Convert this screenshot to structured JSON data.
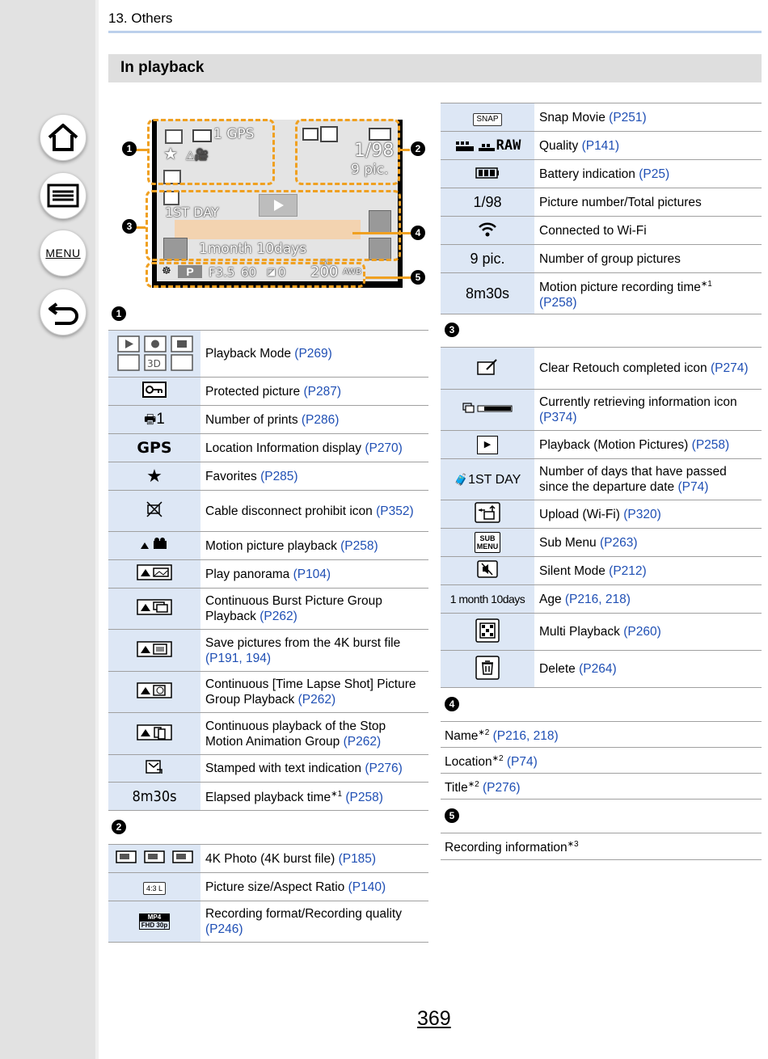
{
  "header": {
    "chapter": "13. Others",
    "section_title": "In playback"
  },
  "nav": {
    "menu_label": "MENU"
  },
  "page_number": "369",
  "screen": {
    "prints": "1 GPS",
    "picnum": "1/98",
    "group": "9 pic.",
    "day": "1ST DAY",
    "age": "1month  10days",
    "aperture": "F3.5",
    "shutter": "60",
    "ev": "0",
    "iso": "200",
    "iso_label": "ISO",
    "awb": "AWB",
    "p_mode": "P",
    "markers": [
      "1",
      "2",
      "3",
      "4",
      "5"
    ]
  },
  "section1": {
    "marker": "1",
    "rows": [
      {
        "icon": "playback-mode-icons",
        "desc": "Playback Mode ",
        "refs": "(P269)"
      },
      {
        "icon": "O-n",
        "desc": "Protected picture ",
        "refs": "(P287)"
      },
      {
        "icon": "1",
        "desc": "Number of prints ",
        "refs": "(P286)"
      },
      {
        "icon": "GPS",
        "desc": "Location Information display ",
        "refs": "(P270)"
      },
      {
        "icon": "★",
        "desc": "Favorites ",
        "refs": "(P285)"
      },
      {
        "icon": "cable",
        "desc": "Cable disconnect prohibit icon ",
        "refs": "(P352)"
      },
      {
        "icon": "motion",
        "desc": "Motion picture playback ",
        "refs": "(P258)"
      },
      {
        "icon": "pano",
        "desc": "Play panorama ",
        "refs": "(P104)"
      },
      {
        "icon": "burst",
        "desc": "Continuous Burst Picture Group Playback ",
        "refs": "(P262)"
      },
      {
        "icon": "4k",
        "desc": "Save pictures from the 4K burst file ",
        "refs": "(P191, 194)"
      },
      {
        "icon": "timelapse",
        "desc": "Continuous [Time Lapse Shot] Picture Group Playback ",
        "refs": "(P262)"
      },
      {
        "icon": "stop",
        "desc": "Continuous playback of the Stop Motion Animation Group ",
        "refs": "(P262)"
      },
      {
        "icon": "stamp",
        "desc": "Stamped with text indication ",
        "refs": "(P276)"
      },
      {
        "icon": "8m30s",
        "desc": "Elapsed playback time",
        "sup": "∗1",
        "refs": " (P258)"
      }
    ]
  },
  "section2": {
    "marker": "2",
    "rows": [
      {
        "icon": "4k-photo",
        "desc": "4K Photo (4K burst file) ",
        "refs": "(P185)"
      },
      {
        "icon": "4:3 L",
        "desc": "Picture size/Aspect Ratio ",
        "refs": "(P140)"
      },
      {
        "icon_top": "MP4",
        "icon_bottom": "FHD 30p",
        "desc": "Recording format/Recording quality ",
        "refs": "(P246)"
      }
    ]
  },
  "section2b": {
    "rows": [
      {
        "icon": "SNAP",
        "desc": "Snap Movie ",
        "refs": "(P251)"
      },
      {
        "icon": "RAW",
        "desc": "Quality ",
        "refs": "(P141)"
      },
      {
        "icon": "battery",
        "desc": "Battery indication ",
        "refs": "(P25)"
      },
      {
        "icon": "1/98",
        "desc": "Picture number/Total pictures",
        "refs": ""
      },
      {
        "icon": "wifi",
        "desc": "Connected to Wi-Fi",
        "refs": ""
      },
      {
        "icon": "9 pic.",
        "desc": "Number of group pictures",
        "refs": ""
      },
      {
        "icon": "8m30s",
        "desc": "Motion picture recording time",
        "sup": "∗1",
        "refs": "(P258)"
      }
    ]
  },
  "section3": {
    "marker": "3",
    "rows": [
      {
        "icon": "retouch",
        "desc": "Clear Retouch completed icon ",
        "refs": "(P274)"
      },
      {
        "icon": "retrieving",
        "desc": "Currently retrieving information icon ",
        "refs": "(P374)"
      },
      {
        "icon": "▶",
        "desc": "Playback (Motion Pictures) ",
        "refs": "(P258)"
      },
      {
        "icon": "1ST DAY",
        "desc": "Number of days that have passed since the departure date ",
        "refs": "(P74)"
      },
      {
        "icon": "upload",
        "desc": "Upload (Wi-Fi) ",
        "refs": "(P320)"
      },
      {
        "icon_top": "SUB",
        "icon_bottom": "MENU",
        "desc": "Sub Menu ",
        "refs": "(P263)"
      },
      {
        "icon": "silent",
        "desc": "Silent Mode ",
        "refs": "(P212)"
      },
      {
        "icon": "1 month 10days",
        "desc": "Age ",
        "refs": "(P216, 218)"
      },
      {
        "icon": "multi",
        "desc": "Multi Playback ",
        "refs": "(P260)"
      },
      {
        "icon": "delete",
        "desc": "Delete ",
        "refs": "(P264)"
      }
    ]
  },
  "section4": {
    "marker": "4",
    "rows": [
      {
        "label": "Name",
        "sup": "∗2",
        "refs": " (P216, 218)"
      },
      {
        "label": "Location",
        "sup": "∗2",
        "refs": " (P74)"
      },
      {
        "label": "Title",
        "sup": "∗2",
        "refs": " (P276)"
      }
    ]
  },
  "section5": {
    "marker": "5",
    "rows": [
      {
        "label": "Recording information",
        "sup": "∗3",
        "refs": ""
      }
    ]
  }
}
